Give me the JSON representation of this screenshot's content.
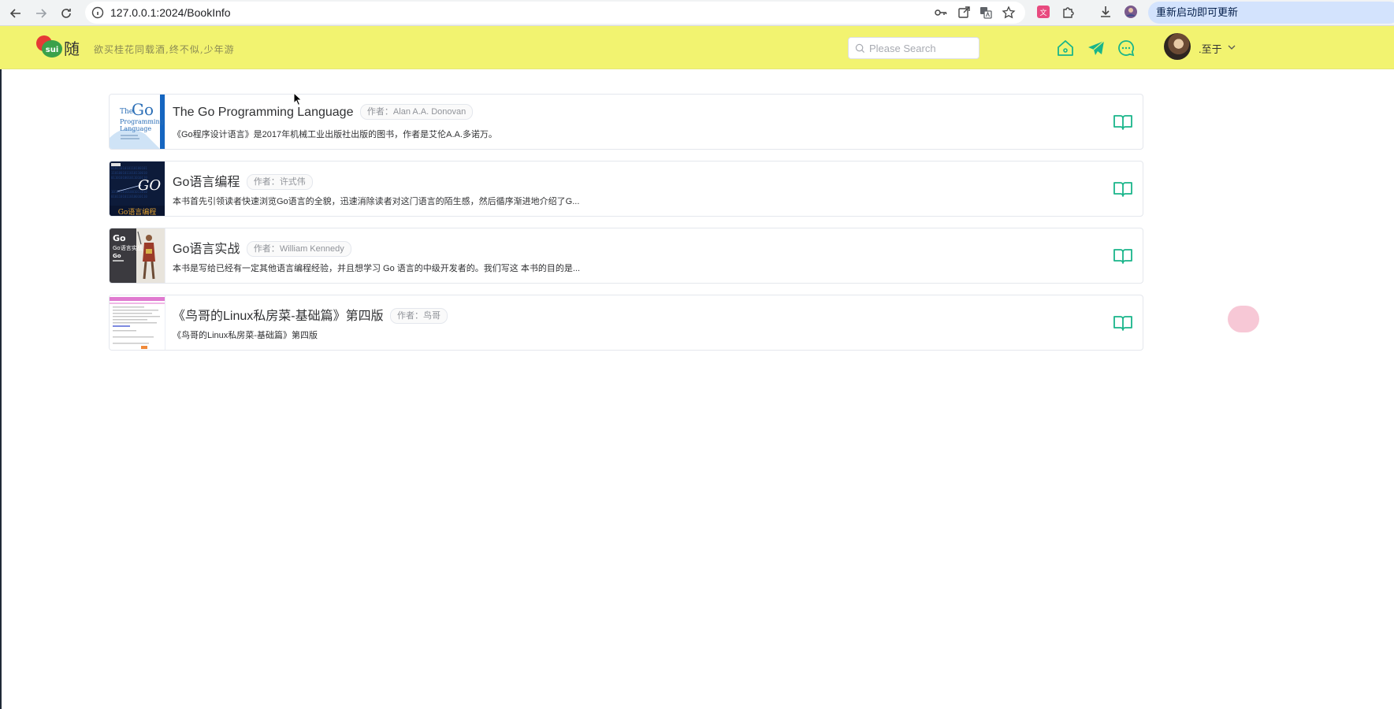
{
  "browser": {
    "url": "127.0.0.1:2024/BookInfo",
    "update_button_label": "重新启动即可更新",
    "icons": [
      "back-icon",
      "forward-icon",
      "reload-icon",
      "site-info-icon",
      "password-key-icon",
      "open-external-icon",
      "translate-icon",
      "bookmark-star-icon",
      "extension-icon",
      "puzzle-icon",
      "download-icon",
      "profile-icon"
    ]
  },
  "header": {
    "logo_text": "sui",
    "logo_char": "随",
    "slogan": "欲买桂花同载酒,终不似,少年游",
    "search_placeholder": "Please Search",
    "user_name": ".至于",
    "colors": {
      "background": "#f2f370",
      "accent": "#19b58a"
    }
  },
  "books": {
    "author_label": "作者：",
    "items": [
      {
        "title": "The Go Programming Language",
        "author": "Alan A.A. Donovan",
        "description": "《Go程序设计语言》是2017年机械工业出版社出版的图书，作者是艾伦A.A.多诺万。",
        "cover": "go-programming-language-cover"
      },
      {
        "title": "Go语言编程",
        "author": "许式伟",
        "description": "本书首先引领读者快速浏览Go语言的全貌，迅速消除读者对这门语言的陌生感，然后循序渐进地介绍了G...",
        "cover": "go-language-programming-cover",
        "cover_text": "Go语言编程"
      },
      {
        "title": "Go语言实战",
        "author": "William Kennedy",
        "description": "本书是写给已经有一定其他语言编程经验，并且想学习 Go 语言的中级开发者的。我们写这 本书的目的是...",
        "cover": "go-in-action-cover",
        "cover_text": "Go语言实战"
      },
      {
        "title": "《鸟哥的Linux私房菜-基础篇》第四版",
        "author": "鸟哥",
        "description": "《鸟哥的Linux私房菜-基础篇》第四版",
        "cover": "linux-book-document-cover"
      }
    ]
  }
}
